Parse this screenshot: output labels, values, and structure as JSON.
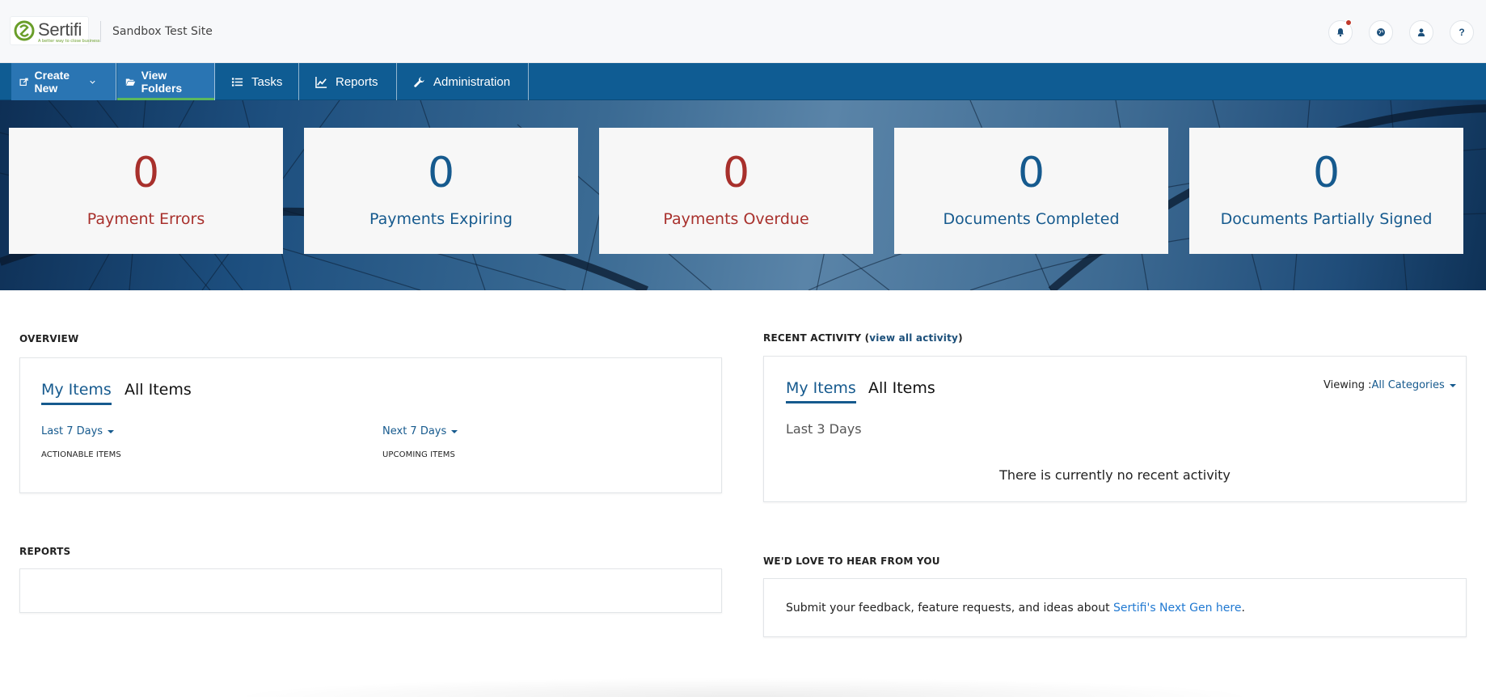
{
  "header": {
    "logo_text": "Sertifi",
    "logo_tagline": "A better way to close business.",
    "site_name": "Sandbox Test Site",
    "icons": [
      "bell-icon",
      "globe-icon",
      "user-icon",
      "help-icon"
    ],
    "help_label": "?"
  },
  "nav": {
    "create_new": "Create New",
    "view_folders": "View Folders",
    "tasks": "Tasks",
    "reports": "Reports",
    "administration": "Administration"
  },
  "stats": [
    {
      "value": "0",
      "label": "Payment Errors",
      "color": "#a8302c"
    },
    {
      "value": "0",
      "label": "Payments Expiring",
      "color": "#165a8e"
    },
    {
      "value": "0",
      "label": "Payments Overdue",
      "color": "#a8302c"
    },
    {
      "value": "0",
      "label": "Documents Completed",
      "color": "#165a8e"
    },
    {
      "value": "0",
      "label": "Documents Partially Signed",
      "color": "#165a8e"
    }
  ],
  "overview": {
    "title": "OVERVIEW",
    "tab_my": "My Items",
    "tab_all": "All Items",
    "left_range": "Last 7 Days",
    "left_caption": "ACTIONABLE ITEMS",
    "right_range": "Next 7 Days",
    "right_caption": "UPCOMING ITEMS"
  },
  "recent": {
    "title": "RECENT ACTIVITY (",
    "link": "view all activity",
    "title_end": ")",
    "tab_my": "My Items",
    "tab_all": "All Items",
    "viewing_label": "Viewing :",
    "viewing_value": "All Categories",
    "range": "Last 3 Days",
    "empty": "There is currently no recent activity"
  },
  "reports": {
    "title": "REPORTS"
  },
  "feedback": {
    "title": "WE'D LOVE TO HEAR FROM YOU",
    "text": "Submit your feedback, feature requests, and ideas about ",
    "link": "Sertifi's Next Gen here",
    "end": "."
  },
  "colors": {
    "nav_bg": "#0f5c93",
    "nav_active": "#2a75b3",
    "accent_green": "#5cb85c",
    "stat_red": "#a8302c",
    "stat_blue": "#165a8e"
  }
}
